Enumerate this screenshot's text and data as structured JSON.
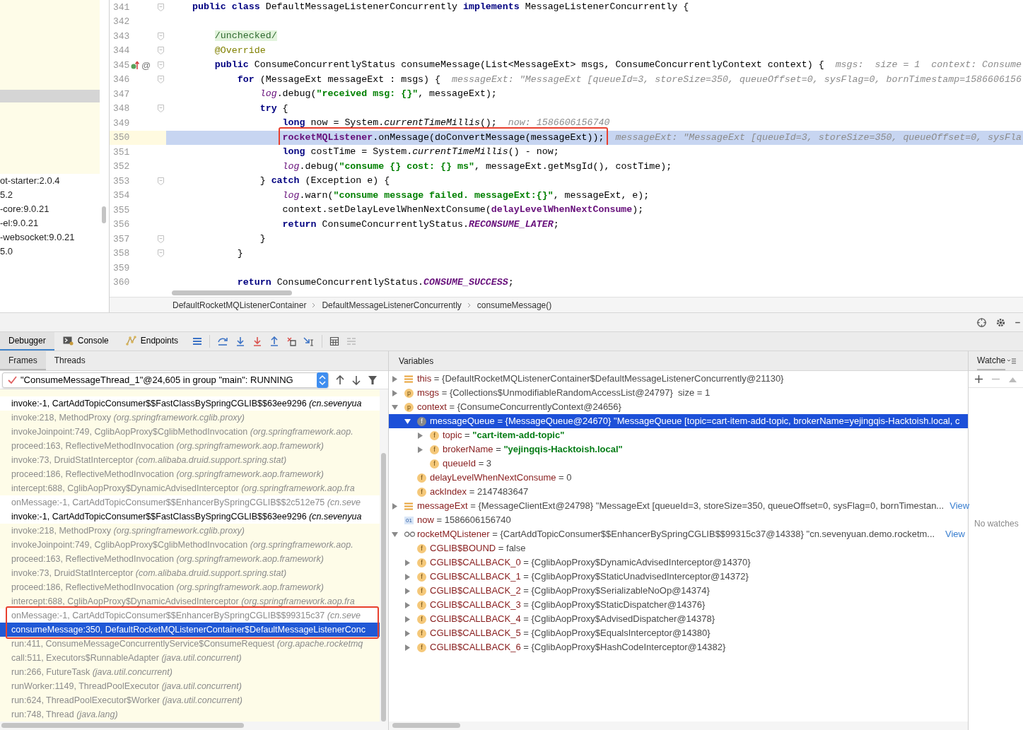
{
  "project_tree": {
    "items": [
      {
        "label": "ot-starter:2.0.4"
      },
      {
        "label": "5.2"
      },
      {
        "label": "-core:9.0.21"
      },
      {
        "label": "-el:9.0.21"
      },
      {
        "label": "-websocket:9.0.21"
      },
      {
        "label": "5.0"
      }
    ]
  },
  "editor": {
    "lines": [
      {
        "number": "341",
        "fold": true,
        "current": false,
        "boxed": false,
        "segments": [
          {
            "kind": "kw",
            "text": "    public class "
          },
          {
            "kind": "plain",
            "text": "DefaultMessageListenerConcurrently "
          },
          {
            "kind": "kw",
            "text": "implements "
          },
          {
            "kind": "plain",
            "text": "MessageListenerConcurrently {"
          }
        ]
      },
      {
        "number": "342",
        "fold": false,
        "current": false,
        "boxed": false
      },
      {
        "number": "343",
        "fold": true,
        "current": false,
        "boxed": false,
        "segments": [
          {
            "kind": "inspection",
            "text": "        /unchecked/"
          }
        ]
      },
      {
        "number": "344",
        "fold": true,
        "current": false,
        "boxed": false,
        "segments": [
          {
            "kind": "ann",
            "text": "        @Override"
          }
        ]
      },
      {
        "number": "345",
        "fold": true,
        "current": false,
        "boxed": false,
        "gutter": {
          "override": true,
          "mark": "@"
        },
        "segments": [
          {
            "kind": "kw",
            "text": "        public "
          },
          {
            "kind": "plain",
            "text": "ConsumeConcurrentlyStatus consumeMessage(List<MessageExt> msgs, ConsumeConcurrentlyContext context) {"
          }
        ],
        "hint": "msgs:  size = 1  context: Consume"
      },
      {
        "number": "346",
        "fold": true,
        "current": false,
        "boxed": false,
        "segments": [
          {
            "kind": "kw",
            "text": "            for "
          },
          {
            "kind": "plain",
            "text": "(MessageExt messageExt : msgs) {"
          }
        ],
        "hint": "messageExt: \"MessageExt [queueId=3, storeSize=350, queueOffset=0, sysFlag=0, bornTimestamp=1586606156"
      },
      {
        "number": "347",
        "fold": false,
        "current": false,
        "boxed": false,
        "segments": [
          {
            "kind": "log",
            "text": "                log"
          },
          {
            "kind": "plain",
            "text": ".debug("
          },
          {
            "kind": "str",
            "text": "\"received msg: {}\""
          },
          {
            "kind": "plain",
            "text": ", messageExt);"
          }
        ]
      },
      {
        "number": "348",
        "fold": true,
        "current": false,
        "boxed": false,
        "segments": [
          {
            "kind": "kw",
            "text": "                try "
          },
          {
            "kind": "plain",
            "text": "{"
          }
        ]
      },
      {
        "number": "349",
        "fold": false,
        "current": false,
        "boxed": false,
        "segments": [
          {
            "kind": "kw",
            "text": "                    long "
          },
          {
            "kind": "plain",
            "text": "now = System."
          },
          {
            "kind": "italic",
            "text": "currentTimeMillis"
          },
          {
            "kind": "plain",
            "text": "();"
          }
        ],
        "hint": "now: 1586606156740"
      },
      {
        "number": "350",
        "fold": false,
        "current": true,
        "boxed": true,
        "segments": [
          {
            "kind": "field",
            "text": "                    rocketMQListener"
          },
          {
            "kind": "plain",
            "text": ".onMessage(doConvertMessage(messageExt));"
          }
        ],
        "hint": "messageExt: \"MessageExt [queueId=3, storeSize=350, queueOffset=0, sysFla"
      },
      {
        "number": "351",
        "fold": false,
        "current": false,
        "boxed": false,
        "segments": [
          {
            "kind": "kw",
            "text": "                    long "
          },
          {
            "kind": "plain",
            "text": "costTime = System."
          },
          {
            "kind": "italic",
            "text": "currentTimeMillis"
          },
          {
            "kind": "plain",
            "text": "() - now;"
          }
        ]
      },
      {
        "number": "352",
        "fold": false,
        "current": false,
        "boxed": false,
        "segments": [
          {
            "kind": "log",
            "text": "                    log"
          },
          {
            "kind": "plain",
            "text": ".debug("
          },
          {
            "kind": "str",
            "text": "\"consume {} cost: {} ms\""
          },
          {
            "kind": "plain",
            "text": ", messageExt.getMsgId(), costTime);"
          }
        ]
      },
      {
        "number": "353",
        "fold": true,
        "current": false,
        "boxed": false,
        "segments": [
          {
            "kind": "plain",
            "text": "                } "
          },
          {
            "kind": "kw",
            "text": "catch "
          },
          {
            "kind": "plain",
            "text": "(Exception e) {"
          }
        ]
      },
      {
        "number": "354",
        "fold": false,
        "current": false,
        "boxed": false,
        "segments": [
          {
            "kind": "log",
            "text": "                    log"
          },
          {
            "kind": "plain",
            "text": ".warn("
          },
          {
            "kind": "str",
            "text": "\"consume message failed. messageExt:{}\""
          },
          {
            "kind": "plain",
            "text": ", messageExt, e);"
          }
        ]
      },
      {
        "number": "355",
        "fold": false,
        "current": false,
        "boxed": false,
        "segments": [
          {
            "kind": "plain",
            "text": "                    context.setDelayLevelWhenNextConsume("
          },
          {
            "kind": "field",
            "text": "delayLevelWhenNextConsume"
          },
          {
            "kind": "plain",
            "text": ");"
          }
        ]
      },
      {
        "number": "356",
        "fold": false,
        "current": false,
        "boxed": false,
        "segments": [
          {
            "kind": "kw",
            "text": "                    return "
          },
          {
            "kind": "plain",
            "text": "ConsumeConcurrentlyStatus."
          },
          {
            "kind": "static",
            "text": "RECONSUME_LATER"
          },
          {
            "kind": "plain",
            "text": ";"
          }
        ]
      },
      {
        "number": "357",
        "fold": true,
        "current": false,
        "boxed": false,
        "segments": [
          {
            "kind": "plain",
            "text": "                }"
          }
        ]
      },
      {
        "number": "358",
        "fold": true,
        "current": false,
        "boxed": false,
        "segments": [
          {
            "kind": "plain",
            "text": "            }"
          }
        ]
      },
      {
        "number": "359",
        "fold": false,
        "current": false,
        "boxed": false
      },
      {
        "number": "360",
        "fold": false,
        "current": false,
        "boxed": false,
        "segments": [
          {
            "kind": "kw",
            "text": "            return "
          },
          {
            "kind": "plain",
            "text": "ConsumeConcurrentlyStatus."
          },
          {
            "kind": "static",
            "text": "CONSUME_SUCCESS"
          },
          {
            "kind": "plain",
            "text": ";"
          }
        ]
      }
    ],
    "breadcrumbs": [
      "DefaultRocketMQListenerContainer",
      "DefaultMessageListenerConcurrently",
      "consumeMessage()"
    ]
  },
  "debug_tabs": [
    {
      "label": "Debugger",
      "selected": true,
      "kind": "plain"
    },
    {
      "label": "Console",
      "selected": false,
      "kind": "console"
    },
    {
      "label": "Endpoints",
      "selected": false,
      "kind": "endpoints"
    }
  ],
  "frames_panel": {
    "tabs": [
      {
        "label": "Frames",
        "selected": true
      },
      {
        "label": "Threads",
        "selected": false
      }
    ],
    "thread": "\"ConsumeMessageThread_1\"@24,605 in group \"main\": RUNNING",
    "frames": [
      {
        "method": "invoke:-1, CartAddTopicConsumer$$FastClassBySpringCGLIB$$63ee9296",
        "package": "(cn.sevenyua",
        "kind": "user",
        "selected": false,
        "boxed": false
      },
      {
        "method": "invoke:218, MethodProxy",
        "package": "(org.springframework.cglib.proxy)",
        "kind": "library",
        "selected": false,
        "boxed": false
      },
      {
        "method": "invokeJoinpoint:749, CglibAopProxy$CglibMethodInvocation",
        "package": "(org.springframework.aop.",
        "kind": "library",
        "selected": false,
        "boxed": false
      },
      {
        "method": "proceed:163, ReflectiveMethodInvocation",
        "package": "(org.springframework.aop.framework)",
        "kind": "library",
        "selected": false,
        "boxed": false
      },
      {
        "method": "invoke:73, DruidStatInterceptor",
        "package": "(com.alibaba.druid.support.spring.stat)",
        "kind": "library",
        "selected": false,
        "boxed": false
      },
      {
        "method": "proceed:186, ReflectiveMethodInvocation",
        "package": "(org.springframework.aop.framework)",
        "kind": "library",
        "selected": false,
        "boxed": false
      },
      {
        "method": "intercept:688, CglibAopProxy$DynamicAdvisedInterceptor",
        "package": "(org.springframework.aop.fra",
        "kind": "library",
        "selected": false,
        "boxed": false
      },
      {
        "method": "onMessage:-1, CartAddTopicConsumer$$EnhancerBySpringCGLIB$$2c512e75",
        "package": "(cn.seve",
        "kind": "synthetic",
        "selected": false,
        "boxed": false
      },
      {
        "method": "invoke:-1, CartAddTopicConsumer$$FastClassBySpringCGLIB$$63ee9296",
        "package": "(cn.sevenyua",
        "kind": "user",
        "selected": false,
        "boxed": false
      },
      {
        "method": "invoke:218, MethodProxy",
        "package": "(org.springframework.cglib.proxy)",
        "kind": "library",
        "selected": false,
        "boxed": false
      },
      {
        "method": "invokeJoinpoint:749, CglibAopProxy$CglibMethodInvocation",
        "package": "(org.springframework.aop.",
        "kind": "library",
        "selected": false,
        "boxed": false
      },
      {
        "method": "proceed:163, ReflectiveMethodInvocation",
        "package": "(org.springframework.aop.framework)",
        "kind": "library",
        "selected": false,
        "boxed": false
      },
      {
        "method": "invoke:73, DruidStatInterceptor",
        "package": "(com.alibaba.druid.support.spring.stat)",
        "kind": "library",
        "selected": false,
        "boxed": false
      },
      {
        "method": "proceed:186, ReflectiveMethodInvocation",
        "package": "(org.springframework.aop.framework)",
        "kind": "library",
        "selected": false,
        "boxed": false
      },
      {
        "method": "intercept:688, CglibAopProxy$DynamicAdvisedInterceptor",
        "package": "(org.springframework.aop.fra",
        "kind": "library",
        "selected": false,
        "boxed": false
      },
      {
        "method": "onMessage:-1, CartAddTopicConsumer$$EnhancerBySpringCGLIB$$99315c37",
        "package": "(cn.seve",
        "kind": "synthetic",
        "selected": false,
        "boxed": true
      },
      {
        "method": "consumeMessage:350, DefaultRocketMQListenerContainer$DefaultMessageListenerConc",
        "kind": "user",
        "selected": true,
        "boxed": true
      },
      {
        "method": "run:411, ConsumeMessageConcurrentlyService$ConsumeRequest",
        "package": "(org.apache.rocketmq",
        "kind": "library",
        "selected": false,
        "boxed": false
      },
      {
        "method": "call:511, Executors$RunnableAdapter",
        "package": "(java.util.concurrent)",
        "kind": "library",
        "selected": false,
        "boxed": false
      },
      {
        "method": "run:266, FutureTask",
        "package": "(java.util.concurrent)",
        "kind": "library",
        "selected": false,
        "boxed": false
      },
      {
        "method": "runWorker:1149, ThreadPoolExecutor",
        "package": "(java.util.concurrent)",
        "kind": "library",
        "selected": false,
        "boxed": false
      },
      {
        "method": "run:624, ThreadPoolExecutor$Worker",
        "package": "(java.util.concurrent)",
        "kind": "library",
        "selected": false,
        "boxed": false
      },
      {
        "method": "run:748, Thread",
        "package": "(java.lang)",
        "kind": "library",
        "selected": false,
        "boxed": false
      }
    ]
  },
  "variables_panel": {
    "title": "Variables",
    "items": [
      {
        "name": "this",
        "value": "= {DefaultRocketMQListenerContainer$DefaultMessageListenerConcurrently@21130}",
        "kind": "object",
        "expanded": false,
        "selected": false
      },
      {
        "name": "msgs",
        "value": "= {Collections$UnmodifiableRandomAccessList@24797}  size = 1",
        "kind": "badge",
        "badge": "p",
        "expanded": false,
        "selected": false
      },
      {
        "name": "context",
        "value": "= {ConsumeConcurrentlyContext@24656}",
        "kind": "badge",
        "badge": "p",
        "expanded": true,
        "selected": false,
        "children": [
          {
            "name": "messageQueue",
            "value": "= {MessageQueue@24670} \"MessageQueue [topic=cart-item-add-topic, brokerName=yejingqis-Hacktoish.local, c",
            "kind": "badge",
            "badge": "f",
            "expanded": true,
            "selected": true,
            "children": [
              {
                "name": "topic",
                "value": "= \"cart-item-add-topic\"",
                "quoted": true,
                "kind": "badge",
                "badge": "f",
                "expanded": false,
                "selected": false
              },
              {
                "name": "brokerName",
                "value": "= \"yejingqis-Hacktoish.local\"",
                "quoted": true,
                "kind": "badge",
                "badge": "f",
                "expanded": false,
                "selected": false
              },
              {
                "name": "queueId",
                "value": "= 3",
                "kind": "badge",
                "badge": "f",
                "selected": false
              }
            ]
          },
          {
            "name": "delayLevelWhenNextConsume",
            "value": "= 0",
            "kind": "badge",
            "badge": "f",
            "selected": false
          },
          {
            "name": "ackIndex",
            "value": "= 2147483647",
            "kind": "badge",
            "badge": "f",
            "selected": false
          }
        ]
      },
      {
        "name": "messageExt",
        "value": "= {MessageClientExt@24798} \"MessageExt [queueId=3, storeSize=350, queueOffset=0, sysFlag=0, bornTimestan...",
        "kind": "object",
        "expanded": false,
        "selected": false,
        "link": "View"
      },
      {
        "name": "now",
        "value": "= 1586606156740",
        "kind": "primitive",
        "badge": "01",
        "selected": false
      },
      {
        "name": "rocketMQListener",
        "value": "= {CartAddTopicConsumer$$EnhancerBySpringCGLIB$$99315c37@14338} \"cn.sevenyuan.demo.rocketm...",
        "kind": "watch",
        "expanded": true,
        "selected": false,
        "link": "View",
        "children": [
          {
            "name": "CGLIB$BOUND",
            "value": "= false",
            "kind": "badge",
            "badge": "f",
            "selected": false
          },
          {
            "name": "CGLIB$CALLBACK_0",
            "value": "= {CglibAopProxy$DynamicAdvisedInterceptor@14370}",
            "kind": "badge",
            "badge": "f",
            "expanded": false,
            "selected": false
          },
          {
            "name": "CGLIB$CALLBACK_1",
            "value": "= {CglibAopProxy$StaticUnadvisedInterceptor@14372}",
            "kind": "badge",
            "badge": "f",
            "expanded": false,
            "selected": false
          },
          {
            "name": "CGLIB$CALLBACK_2",
            "value": "= {CglibAopProxy$SerializableNoOp@14374}",
            "kind": "badge",
            "badge": "f",
            "expanded": false,
            "selected": false
          },
          {
            "name": "CGLIB$CALLBACK_3",
            "value": "= {CglibAopProxy$StaticDispatcher@14376}",
            "kind": "badge",
            "badge": "f",
            "expanded": false,
            "selected": false
          },
          {
            "name": "CGLIB$CALLBACK_4",
            "value": "= {CglibAopProxy$AdvisedDispatcher@14378}",
            "kind": "badge",
            "badge": "f",
            "expanded": false,
            "selected": false
          },
          {
            "name": "CGLIB$CALLBACK_5",
            "value": "= {CglibAopProxy$EqualsInterceptor@14380}",
            "kind": "badge",
            "badge": "f",
            "expanded": false,
            "selected": false
          },
          {
            "name": "CGLIB$CALLBACK_6",
            "value": "= {CglibAopProxy$HashCodeInterceptor@14382}",
            "kind": "badge",
            "badge": "f",
            "expanded": false,
            "selected": false
          }
        ]
      }
    ]
  },
  "watches_panel": {
    "title": "Watche",
    "empty_text": "No watches"
  }
}
